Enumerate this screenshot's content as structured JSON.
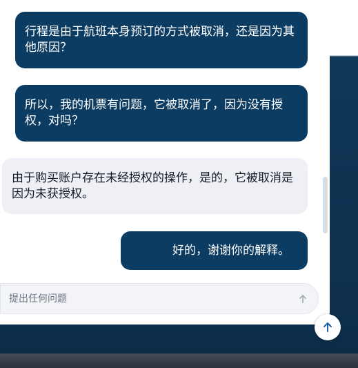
{
  "chat": {
    "messages": [
      {
        "role": "user",
        "text": "行程是由于航班本身预订的方式被取消，还是因为其他原因？"
      },
      {
        "role": "user",
        "text": "所以，我的机票有问题，它被取消了，因为没有授权，对吗？"
      },
      {
        "role": "assistant",
        "text": "由于购买账户存在未经授权的操作，是的，它被取消是因为未获授权。"
      },
      {
        "role": "user",
        "text": "好的，谢谢你的解释。"
      }
    ]
  },
  "composer": {
    "placeholder": "提出任何问题",
    "value": "",
    "send_icon": "arrow-up-icon"
  },
  "scroll_button": {
    "icon": "arrow-up-icon"
  },
  "colors": {
    "user_bubble": "#0c3c62",
    "assistant_bubble": "#eef0f5",
    "scroll_accent": "#1f5fa3"
  }
}
